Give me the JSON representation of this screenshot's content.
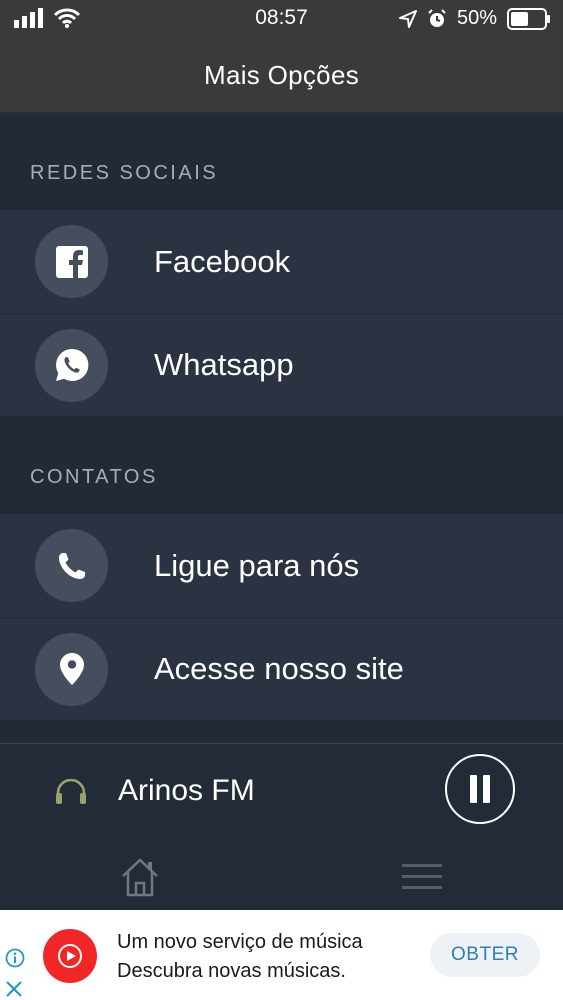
{
  "status_bar": {
    "time": "08:57",
    "battery": "50%",
    "icons": [
      "signal-bars-icon",
      "wifi-icon",
      "location-arrow-icon",
      "alarm-icon",
      "battery-icon"
    ]
  },
  "nav": {
    "title": "Mais Opções"
  },
  "sections": [
    {
      "header": "REDES SOCIAIS",
      "items": [
        {
          "label": "Facebook",
          "icon": "facebook-icon"
        },
        {
          "label": "Whatsapp",
          "icon": "whatsapp-icon"
        }
      ]
    },
    {
      "header": "CONTATOS",
      "items": [
        {
          "label": "Ligue para nós",
          "icon": "phone-icon"
        },
        {
          "label": "Acesse nosso site",
          "icon": "location-pin-icon"
        }
      ]
    }
  ],
  "player": {
    "station": "Arinos FM",
    "state_icon": "pause-icon"
  },
  "tabbar": {
    "items": [
      "home-icon",
      "menu-icon"
    ]
  },
  "ad": {
    "line1": "Um novo serviço de música",
    "line2": "Descubra novas músicas.",
    "button": "OBTER",
    "colors": {
      "logo": "#f12626",
      "button_text": "#2a7fb6"
    }
  },
  "colors": {
    "background": "#222a38",
    "row": "#2b3343",
    "icon_circle": "#464e5d",
    "header_bar": "#3a3a3d",
    "section_text": "#a6adba"
  }
}
